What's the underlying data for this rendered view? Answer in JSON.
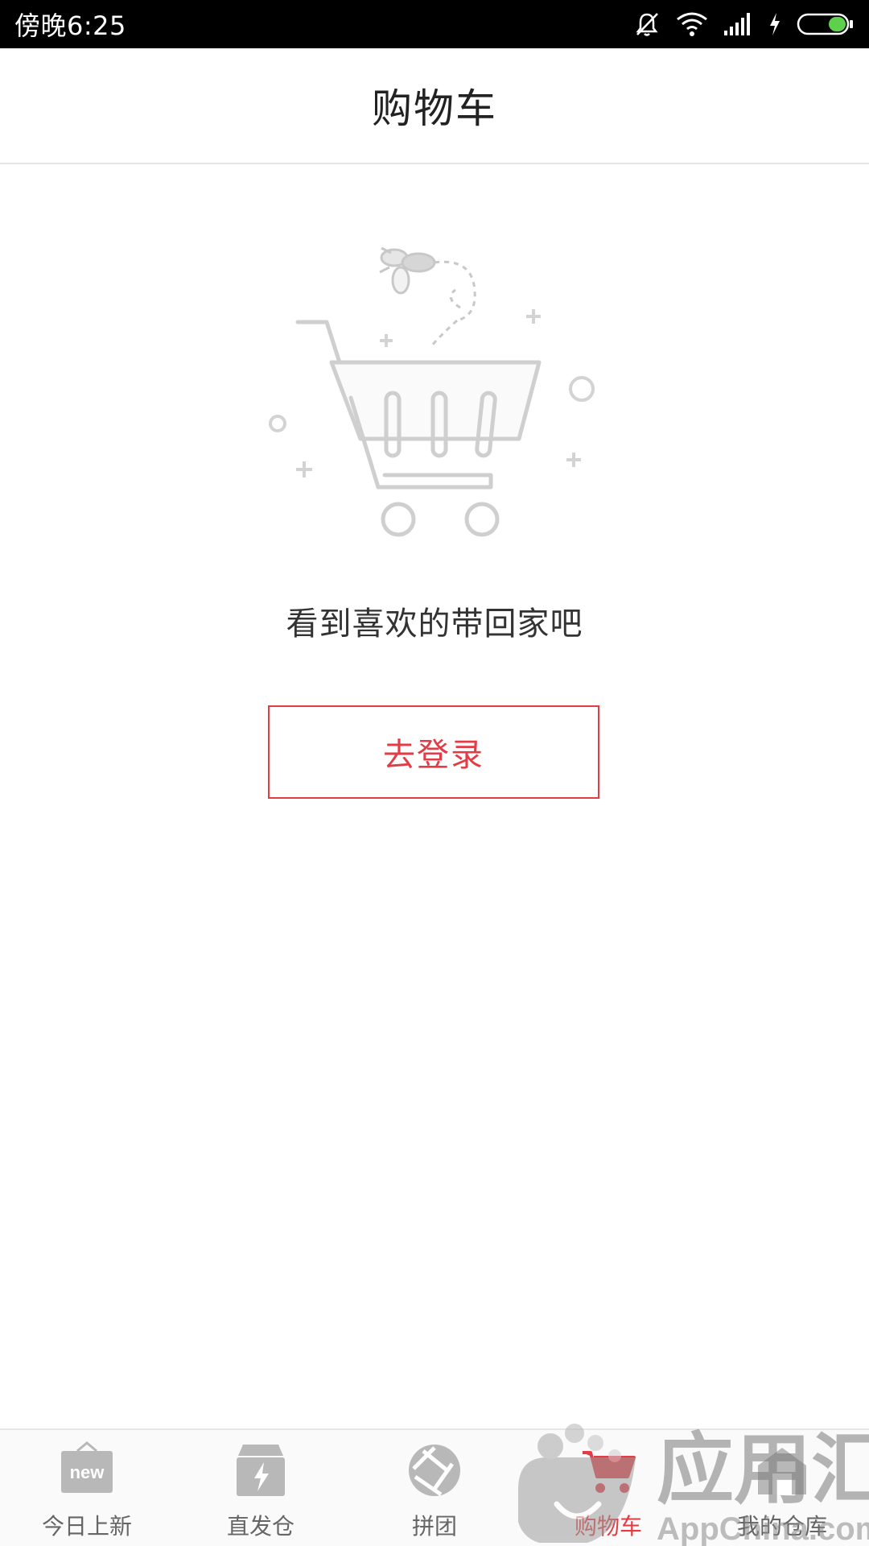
{
  "status_bar": {
    "time": "傍晚6:25"
  },
  "header": {
    "title": "购物车"
  },
  "empty_state": {
    "message": "看到喜欢的带回家吧",
    "login_button": "去登录",
    "illustration_icon": "shopping-cart-with-fly"
  },
  "bottom_nav": {
    "items": [
      {
        "label": "今日上新",
        "icon": "new-bag-icon",
        "active": false
      },
      {
        "label": "直发仓",
        "icon": "lightning-box-icon",
        "active": false
      },
      {
        "label": "拼团",
        "icon": "aperture-icon",
        "active": false
      },
      {
        "label": "购物车",
        "icon": "cart-icon",
        "active": true
      },
      {
        "label": "我的仓库",
        "icon": "warehouse-icon",
        "active": false
      }
    ]
  },
  "watermark": {
    "text": "应用汇",
    "subtext": "AppChina.com"
  },
  "colors": {
    "accent": "#e23c45",
    "status_bar_bg": "#000000",
    "battery_green": "#5fd04b"
  }
}
